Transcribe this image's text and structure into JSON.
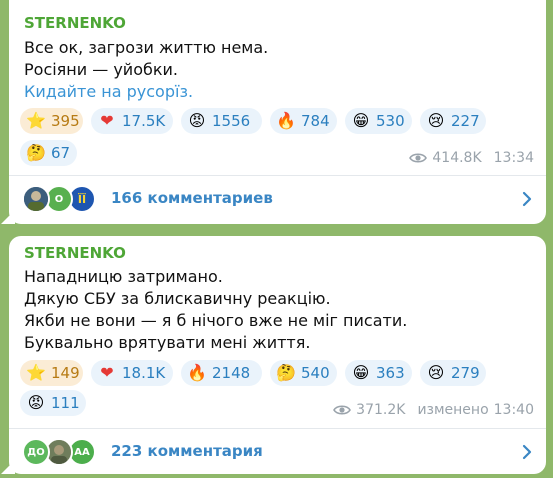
{
  "post1": {
    "author": "STERNENKO",
    "lines": [
      "Все ок, загрози життю нема.",
      "Росіяни — уйобки."
    ],
    "link_text": "Кидайте на русорїз.",
    "reactions": [
      {
        "emoji": "⭐",
        "icon": "star-icon",
        "count": "395"
      },
      {
        "emoji": "❤",
        "icon": "heart-icon",
        "count": "17.5K"
      },
      {
        "emoji": "😡",
        "icon": "angry-face-icon",
        "count": "1556"
      },
      {
        "emoji": "🔥",
        "icon": "fire-icon",
        "count": "784"
      },
      {
        "emoji": "😁",
        "icon": "grinning-face-icon",
        "count": "530"
      },
      {
        "emoji": "😢",
        "icon": "crying-face-icon",
        "count": "227"
      },
      {
        "emoji": "🤔",
        "icon": "thinking-face-icon",
        "count": "67"
      }
    ],
    "views": "414.8K",
    "time": "13:34",
    "comments": "166 комментариев",
    "avatars": [
      {
        "text": "",
        "color": "#2f4f6f",
        "icon": "avatar-photo"
      },
      {
        "text": "O",
        "color": "#58b04f",
        "icon": "avatar-initial"
      },
      {
        "text": "ЇЇ",
        "color": "#1e56b0",
        "icon": "avatar-logo"
      }
    ]
  },
  "post2": {
    "author": "STERNENKO",
    "lines": [
      "Нападницю затримано.",
      "Дякую СБУ за блискавичну реакцію.",
      "Якби не вони — я б нічого вже не міг писати.",
      "Буквально врятувати мені життя."
    ],
    "reactions": [
      {
        "emoji": "⭐",
        "icon": "star-icon",
        "count": "149"
      },
      {
        "emoji": "❤",
        "icon": "heart-icon",
        "count": "18.1K"
      },
      {
        "emoji": "🔥",
        "icon": "fire-icon",
        "count": "2148"
      },
      {
        "emoji": "🤔",
        "icon": "thinking-face-icon",
        "count": "540"
      },
      {
        "emoji": "😁",
        "icon": "grinning-face-icon",
        "count": "363"
      },
      {
        "emoji": "😢",
        "icon": "crying-face-icon",
        "count": "279"
      },
      {
        "emoji": "😡",
        "icon": "angry-face-icon",
        "count": "111"
      }
    ],
    "views": "371.2K",
    "edited_label": "изменено",
    "time": "13:40",
    "comments": "223 комментария",
    "avatars": [
      {
        "text": "ДО",
        "color": "#5cb85c",
        "icon": "avatar-initial"
      },
      {
        "text": "",
        "color": "#7a8b6a",
        "icon": "avatar-photo"
      },
      {
        "text": "AA",
        "color": "#4cae4c",
        "icon": "avatar-initial"
      }
    ]
  },
  "colors": {
    "chat_background": "#8fb86a",
    "author": "#4ea636",
    "link": "#3a94d5",
    "reaction_bg": "#eaf3fb",
    "reaction_selected_bg": "#fbecd5"
  }
}
